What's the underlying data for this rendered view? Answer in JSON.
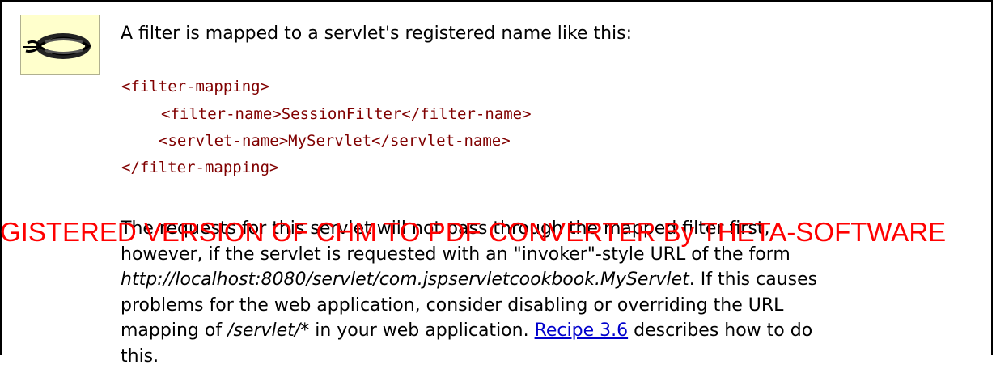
{
  "note": {
    "icon": "binoculars-icon",
    "intro": "A filter is mapped to a servlet's registered name like this:",
    "code_lines": [
      "<filter-mapping>",
      "<filter-name>SessionFilter</filter-name>",
      "<servlet-name>MyServlet</servlet-name>",
      "</filter-mapping>"
    ],
    "para_line1": "The requests for this servlet will not pass through the mapped filter first,",
    "para_line2": "however, if the servlet is requested with an \"invoker\"-style URL of the form",
    "para_url": "http://localhost:8080/servlet/com.jspservletcookbook.MyServlet",
    "para_line3_rest": ". If this causes",
    "para_line4": "problems for the web application, consider disabling or overriding the URL",
    "para_line5_pre": "mapping of ",
    "para_path": "/servlet/*",
    "para_line5_mid": " in your web application. ",
    "recipe_link": "Recipe 3.6",
    "para_line5_post": " describes how to do",
    "para_line6": "this."
  },
  "watermark": {
    "text": "GISTERED VERSION OF CHM TO PDF CONVERTER By THETA-SOFTWARE",
    "color": "#ff0000"
  },
  "colors": {
    "code": "#800000",
    "link": "#0000cc",
    "icon_bg": "#ffffcc"
  }
}
